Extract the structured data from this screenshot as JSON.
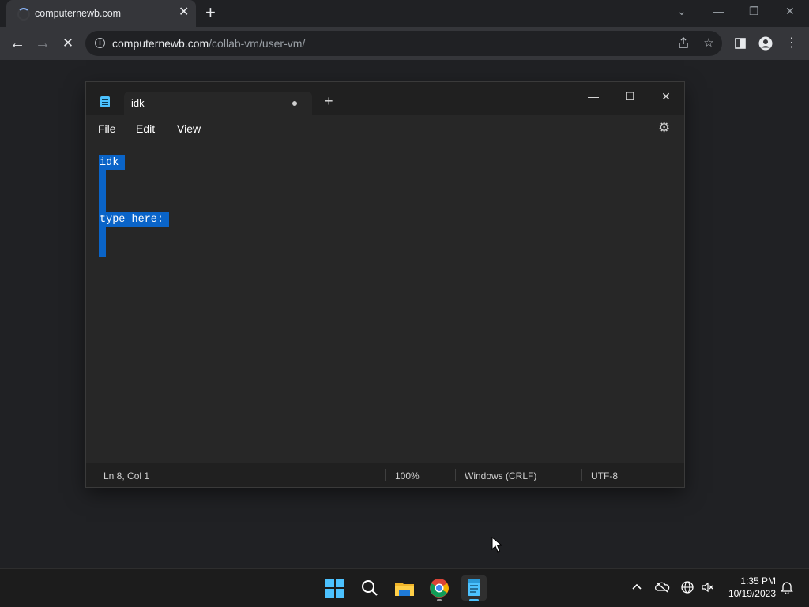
{
  "browser": {
    "tab_title": "computernewb.com",
    "tab_close": "✕",
    "new_tab": "+",
    "url_host": "computernewb.com",
    "url_path": "/collab-vm/user-vm/",
    "info_glyph": "i",
    "window_controls": {
      "tabsearch": "⌄",
      "minimize": "—",
      "restore": "❐",
      "close": "✕"
    }
  },
  "notepad": {
    "tab_title": "idk",
    "new_tab": "+",
    "menu": [
      "File",
      "Edit",
      "View"
    ],
    "content_lines": [
      "idk",
      "",
      "",
      "type here:",
      "",
      ""
    ],
    "status": {
      "position": "Ln 8, Col 1",
      "zoom": "100%",
      "line_ending": "Windows (CRLF)",
      "encoding": "UTF-8"
    },
    "window_controls": {
      "minimize": "—",
      "maximize": "☐",
      "close": "✕"
    },
    "selection_color": "#0a64c8"
  },
  "taskbar": {
    "apps": [
      "start-icon",
      "search-icon",
      "file-explorer-icon",
      "chrome-icon",
      "notepad-icon"
    ],
    "tray": [
      "chevron-up-icon",
      "onedrive-icon",
      "network-icon",
      "volume-muted-icon",
      "notification-bell-icon"
    ],
    "time": "1:35 PM",
    "date": "10/19/2023"
  },
  "colors": {
    "accent": "#4cc2ff",
    "selection": "#0a64c8",
    "desktop": "#202124"
  }
}
